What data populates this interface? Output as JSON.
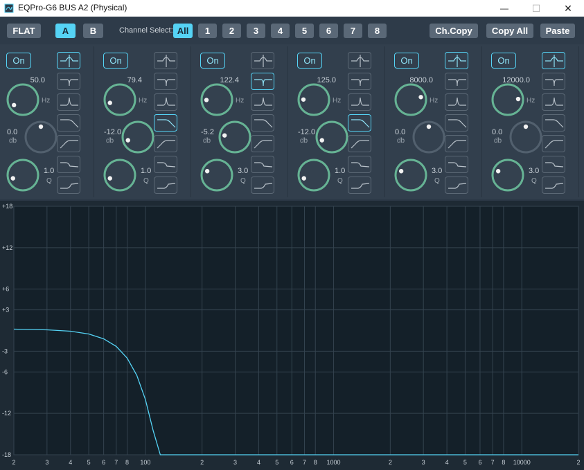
{
  "window": {
    "title": "EQPro-G6 BUS A2 (Physical)",
    "minimize_glyph": "—",
    "maximize_glyph": "☐",
    "close_glyph": "✕"
  },
  "toolbar": {
    "flat_label": "FLAT",
    "a_label": "A",
    "b_label": "B",
    "channel_select_label": "Channel Select:",
    "channels": [
      "All",
      "1",
      "2",
      "3",
      "4",
      "5",
      "6",
      "7",
      "8"
    ],
    "active_channel": "All",
    "active_bank": "A",
    "ch_copy_label": "Ch.Copy",
    "copy_all_label": "Copy All",
    "paste_label": "Paste"
  },
  "units": {
    "freq": "Hz",
    "gain": "db",
    "q": "Q"
  },
  "bands": [
    {
      "on_label": "On",
      "freq": "50.0",
      "gain": "0.0",
      "q": "1.0",
      "gain_active": false,
      "selected_filter": 0,
      "freq_norm": 0.05,
      "gain_norm": 0.5,
      "q_norm": 0.1
    },
    {
      "on_label": "On",
      "freq": "79.4",
      "gain": "-12.0",
      "q": "1.0",
      "gain_active": true,
      "selected_filter": 3,
      "freq_norm": 0.1,
      "gain_norm": 0.1,
      "q_norm": 0.1
    },
    {
      "on_label": "On",
      "freq": "122.4",
      "gain": "-5.2",
      "q": "3.0",
      "gain_active": true,
      "selected_filter": 1,
      "freq_norm": 0.16,
      "gain_norm": 0.2,
      "q_norm": 0.25
    },
    {
      "on_label": "On",
      "freq": "125.0",
      "gain": "-12.0",
      "q": "1.0",
      "gain_active": true,
      "selected_filter": 3,
      "freq_norm": 0.17,
      "gain_norm": 0.1,
      "q_norm": 0.1
    },
    {
      "on_label": "On",
      "freq": "8000.0",
      "gain": "0.0",
      "q": "3.0",
      "gain_active": false,
      "selected_filter": 0,
      "freq_norm": 0.78,
      "gain_norm": 0.5,
      "q_norm": 0.25
    },
    {
      "on_label": "On",
      "freq": "12000.0",
      "gain": "0.0",
      "q": "3.0",
      "gain_active": false,
      "selected_filter": 0,
      "freq_norm": 0.82,
      "gain_norm": 0.5,
      "q_norm": 0.25
    }
  ],
  "filter_types": [
    "bell-icon",
    "notch-icon",
    "peak-icon",
    "low-pass-icon",
    "high-pass-icon",
    "low-shelf-icon",
    "high-shelf-icon"
  ],
  "colors": {
    "accent": "#55d3f5",
    "knob_ring": "#66b394",
    "knob_ring_inactive": "#52606e",
    "curve": "#55d3f5"
  },
  "chart_data": {
    "type": "line",
    "x_scale": "log",
    "xlim": [
      20,
      20000
    ],
    "ylim": [
      -18,
      18
    ],
    "y_ticks": [
      "+18",
      "+12",
      "+6",
      "+3",
      "-3",
      "-6",
      "-12",
      "-18"
    ],
    "y_tick_values": [
      18,
      12,
      6,
      3,
      -3,
      -6,
      -12,
      -18
    ],
    "x_tick_labels": [
      "2",
      "3",
      "4",
      "5",
      "6",
      "7",
      "8",
      "100",
      "2",
      "3",
      "4",
      "5",
      "6",
      "7",
      "8",
      "1000",
      "2",
      "3",
      "4",
      "5",
      "6",
      "7",
      "8",
      "10000",
      "2"
    ],
    "x_tick_values": [
      20,
      30,
      40,
      50,
      60,
      70,
      80,
      100,
      200,
      300,
      400,
      500,
      600,
      700,
      800,
      1000,
      2000,
      3000,
      4000,
      5000,
      6000,
      7000,
      8000,
      10000,
      20000
    ],
    "grid": true,
    "series": [
      {
        "x": [
          20,
          30,
          40,
          50,
          60,
          70,
          80,
          90,
          100,
          110,
          120,
          125,
          200,
          1000,
          10000,
          20000
        ],
        "y": [
          0.2,
          0.1,
          -0.1,
          -0.5,
          -1.2,
          -2.3,
          -4.0,
          -6.5,
          -10.0,
          -14.5,
          -18,
          -18,
          -18,
          -18,
          -18,
          -18
        ]
      }
    ]
  }
}
